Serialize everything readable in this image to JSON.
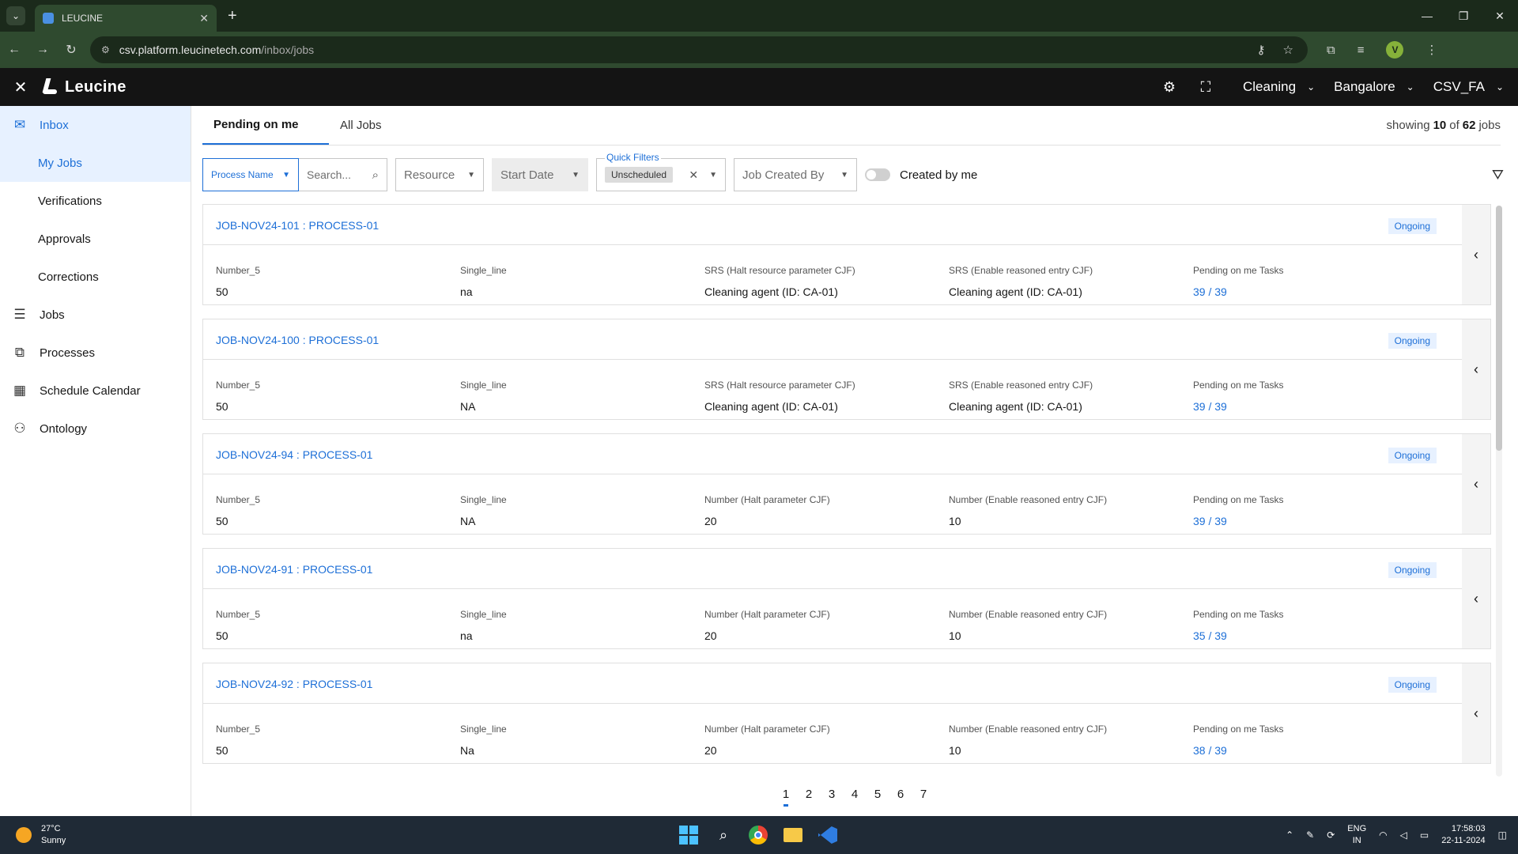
{
  "browser": {
    "tab_title": "LEUCINE",
    "url_domain": "csv.platform.leucinetech.com",
    "url_path": "/inbox/jobs",
    "profile_initial": "V"
  },
  "header": {
    "brand": "Leucine",
    "facility": "Cleaning",
    "site": "Bangalore",
    "user_role": "CSV_FA"
  },
  "sidebar": {
    "inbox": "Inbox",
    "my_jobs": "My Jobs",
    "verifications": "Verifications",
    "approvals": "Approvals",
    "corrections": "Corrections",
    "jobs": "Jobs",
    "processes": "Processes",
    "schedule_calendar": "Schedule Calendar",
    "ontology": "Ontology"
  },
  "tabs": {
    "pending": "Pending on me",
    "all_jobs": "All Jobs"
  },
  "showing": {
    "prefix": "showing",
    "count": "10",
    "of": "of",
    "total": "62",
    "suffix": "jobs"
  },
  "filters": {
    "process_name": "Process Name",
    "search_placeholder": "Search...",
    "resource": "Resource",
    "start_date": "Start Date",
    "quick_filters_label": "Quick Filters",
    "quick_chip": "Unscheduled",
    "job_created_by": "Job Created By",
    "created_by_me": "Created by me"
  },
  "jobs": [
    {
      "name": "JOB-NOV24-101 : PROCESS-01",
      "status": "Ongoing",
      "f1_label": "Number_5",
      "f1_value": "50",
      "f2_label": "Single_line",
      "f2_value": "na",
      "f3_label": "SRS (Halt resource parameter CJF)",
      "f3_value": "Cleaning agent (ID: CA-01)",
      "f4_label": "SRS (Enable reasoned entry CJF)",
      "f4_value": "Cleaning agent (ID: CA-01)",
      "f5_label": "Pending on me Tasks",
      "f5_value": "39 / 39"
    },
    {
      "name": "JOB-NOV24-100 : PROCESS-01",
      "status": "Ongoing",
      "f1_label": "Number_5",
      "f1_value": "50",
      "f2_label": "Single_line",
      "f2_value": "NA",
      "f3_label": "SRS (Halt resource parameter CJF)",
      "f3_value": "Cleaning agent (ID: CA-01)",
      "f4_label": "SRS (Enable reasoned entry CJF)",
      "f4_value": "Cleaning agent (ID: CA-01)",
      "f5_label": "Pending on me Tasks",
      "f5_value": "39 / 39"
    },
    {
      "name": "JOB-NOV24-94 : PROCESS-01",
      "status": "Ongoing",
      "f1_label": "Number_5",
      "f1_value": "50",
      "f2_label": "Single_line",
      "f2_value": "NA",
      "f3_label": "Number (Halt parameter CJF)",
      "f3_value": "20",
      "f4_label": "Number (Enable reasoned entry CJF)",
      "f4_value": "10",
      "f5_label": "Pending on me Tasks",
      "f5_value": "39 / 39"
    },
    {
      "name": "JOB-NOV24-91 : PROCESS-01",
      "status": "Ongoing",
      "f1_label": "Number_5",
      "f1_value": "50",
      "f2_label": "Single_line",
      "f2_value": "na",
      "f3_label": "Number (Halt parameter CJF)",
      "f3_value": "20",
      "f4_label": "Number (Enable reasoned entry CJF)",
      "f4_value": "10",
      "f5_label": "Pending on me Tasks",
      "f5_value": "35 / 39"
    },
    {
      "name": "JOB-NOV24-92 : PROCESS-01",
      "status": "Ongoing",
      "f1_label": "Number_5",
      "f1_value": "50",
      "f2_label": "Single_line",
      "f2_value": "Na",
      "f3_label": "Number (Halt parameter CJF)",
      "f3_value": "20",
      "f4_label": "Number (Enable reasoned entry CJF)",
      "f4_value": "10",
      "f5_label": "Pending on me Tasks",
      "f5_value": "38 / 39"
    }
  ],
  "pagination": [
    "1",
    "2",
    "3",
    "4",
    "5",
    "6",
    "7"
  ],
  "taskbar": {
    "temp": "27°C",
    "weather": "Sunny",
    "lang1": "ENG",
    "lang2": "IN",
    "time": "17:58:03",
    "date": "22-11-2024"
  },
  "colors": {
    "accent": "#1d6fd7",
    "header_bg": "#141414",
    "badge_bg": "#e7f1ff"
  }
}
